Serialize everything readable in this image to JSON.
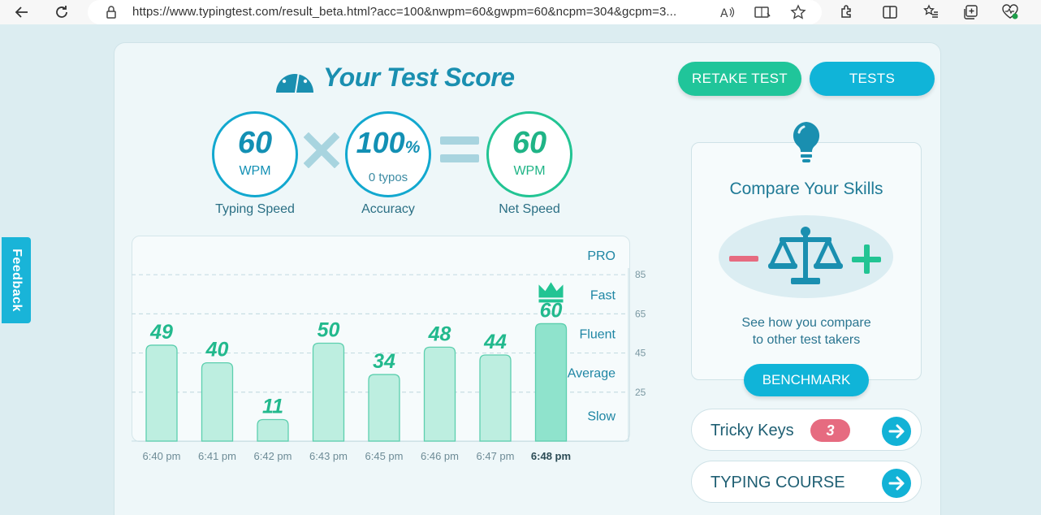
{
  "browser": {
    "url": "https://www.typingtest.com/result_beta.html?acc=100&nwpm=60&gwpm=60&ncpm=304&gcpm=3...",
    "icons": [
      "back-icon",
      "refresh-icon",
      "lock-icon",
      "read-aloud-icon",
      "immersive-reader-icon",
      "favorite-star-icon",
      "extensions-icon",
      "split-screen-icon",
      "favorites-list-icon",
      "collections-icon",
      "browser-essentials-icon"
    ]
  },
  "feedback_label": "Feedback",
  "header": {
    "title": "Your Test Score",
    "retake_label": "RETAKE TEST",
    "tests_label": "TESTS"
  },
  "score": {
    "typing_speed": {
      "value": "60",
      "unit": "WPM",
      "label": "Typing Speed"
    },
    "accuracy": {
      "value": "100",
      "percent": "%",
      "sub": "0 typos",
      "label": "Accuracy"
    },
    "net_speed": {
      "value": "60",
      "unit": "WPM",
      "label": "Net Speed"
    }
  },
  "chart_data": {
    "type": "bar",
    "categories": [
      "6:40 pm",
      "6:41 pm",
      "6:42 pm",
      "6:43 pm",
      "6:45 pm",
      "6:46 pm",
      "6:47 pm",
      "6:48 pm"
    ],
    "values": [
      49,
      40,
      11,
      50,
      34,
      48,
      44,
      60
    ],
    "highlight_index": 7,
    "ylim": [
      0,
      105
    ],
    "yticks": [
      25,
      45,
      65,
      85
    ],
    "bands": [
      {
        "label": "PRO",
        "mid": 95
      },
      {
        "label": "Fast",
        "mid": 75
      },
      {
        "label": "Fluent",
        "mid": 55
      },
      {
        "label": "Average",
        "mid": 35
      },
      {
        "label": "Slow",
        "mid": 13
      }
    ],
    "grid": true,
    "colors": {
      "bar": "#bdeee0",
      "bar_highlight": "#8fe3cc",
      "bar_stroke": "#5ccfae",
      "value_label": "#22b98d",
      "crown": "#22c493"
    }
  },
  "compare": {
    "title": "Compare Your Skills",
    "text_line1": "See how you compare",
    "text_line2": "to other test takers",
    "benchmark_label": "BENCHMARK",
    "minus": "−",
    "plus": "+"
  },
  "tricky_keys": {
    "label": "Tricky Keys",
    "count": "3"
  },
  "typing_course": {
    "label": "TYPING COURSE"
  }
}
